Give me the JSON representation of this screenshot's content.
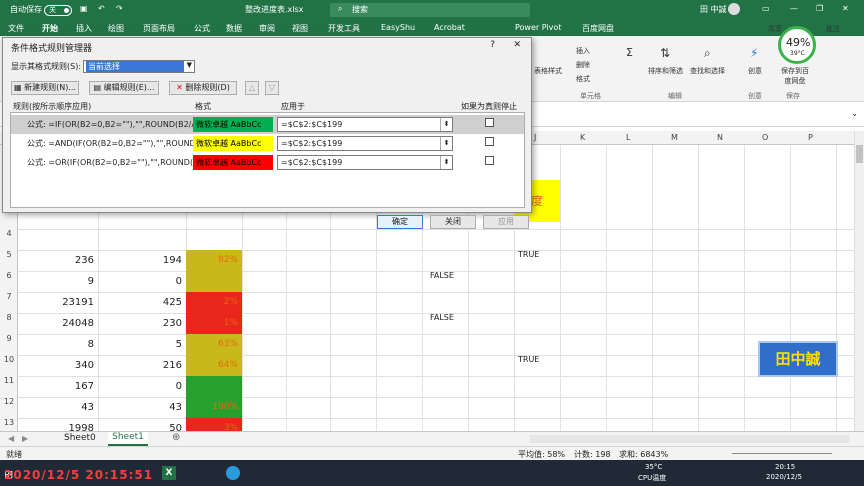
{
  "titlebar": {
    "autosave": "自动保存",
    "autosave_state": "关",
    "filename": "整改进度表.xlsx",
    "user": "田 中誠",
    "search": "搜索"
  },
  "tabs": [
    "文件",
    "开始",
    "插入",
    "绘图",
    "页面布局",
    "公式",
    "数据",
    "审阅",
    "视图",
    "开发工具",
    "EasyShu",
    "Acrobat",
    "Power Pivot",
    "百度网盘"
  ],
  "ribbon": {
    "insert": "插入",
    "delete": "删除",
    "format": "格式",
    "cells_group": "单元格",
    "sort_filter": "排序和筛选",
    "find_select": "查找和选择",
    "edit_group": "编辑",
    "create": "创意",
    "save_cloud": "保存到百度网盘",
    "save_group": "保存",
    "share": "共享",
    "comment": "批注",
    "table_style": "表格样式",
    "cpu_pct": "49%",
    "cpu_temp": "39°C"
  },
  "dialog": {
    "title": "条件格式规则管理器",
    "show_label": "显示其格式规则(S):",
    "show_value": "当前选择",
    "new_rule": "新建规则(N)...",
    "edit_rule": "编辑规则(E)...",
    "delete_rule": "删除规则(D)",
    "col_rule": "规则(按所示顺序应用)",
    "col_format": "格式",
    "col_applies": "应用于",
    "col_stop": "如果为真则停止",
    "rules": [
      {
        "formula": "公式: =IF(OR(B2=0,B2=\"\"),\"\",ROUND(B2/A...",
        "preview": "微软卓越  AaBbCc",
        "applies": "=$C$2:$C$199",
        "bg": "#00b050"
      },
      {
        "formula": "公式: =AND(IF(OR(B2=0,B2=\"\"),\"\",ROUND(B...",
        "preview": "微软卓越  AaBbCc",
        "applies": "=$C$2:$C$199",
        "bg": "#ffff00"
      },
      {
        "formula": "公式: =OR(IF(OR(B2=0,B2=\"\"),\"\",ROUND(...",
        "preview": "微软卓越  AaBbCc",
        "applies": "=$C$2:$C$199",
        "bg": "#ff0000"
      }
    ],
    "ok": "确定",
    "close": "关闭",
    "apply": "应用",
    "help": "?",
    "x": "✕"
  },
  "sheet": {
    "columns": [
      "J",
      "K",
      "L",
      "M",
      "N",
      "O",
      "P"
    ],
    "rows": [
      {
        "num": "4",
        "a": "",
        "b": "",
        "c": "",
        "color": ""
      },
      {
        "num": "5",
        "a": "236",
        "b": "194",
        "c": "82%",
        "color": "#c9b81a"
      },
      {
        "num": "6",
        "a": "9",
        "b": "0",
        "c": "",
        "color": "#c9b81a"
      },
      {
        "num": "7",
        "a": "23191",
        "b": "425",
        "c": "2%",
        "color": "#e8261b"
      },
      {
        "num": "8",
        "a": "24048",
        "b": "230",
        "c": "1%",
        "color": "#e8261b"
      },
      {
        "num": "9",
        "a": "8",
        "b": "5",
        "c": "63%",
        "color": "#c9b81a"
      },
      {
        "num": "10",
        "a": "340",
        "b": "216",
        "c": "64%",
        "color": "#c9b81a"
      },
      {
        "num": "11",
        "a": "167",
        "b": "0",
        "c": "",
        "color": "#27a02e"
      },
      {
        "num": "12",
        "a": "43",
        "b": "43",
        "c": "100%",
        "color": "#27a02e"
      },
      {
        "num": "13",
        "a": "1998",
        "b": "50",
        "c": "3%",
        "color": "#e8261b"
      }
    ],
    "true_label": "TRUE",
    "false_label": "FALSE",
    "header_char": "度",
    "stamp": "田中誠"
  },
  "sheettabs": [
    "Sheet0",
    "Sheet1"
  ],
  "status": {
    "ready": "就绪",
    "avg": "平均值: 58%",
    "count": "计数: 198",
    "sum": "求和: 6843%"
  },
  "taskbar": {
    "temp": "35°C",
    "cpu": "CPU温度",
    "time": "20:15",
    "date": "2020/12/5",
    "overlay": "2020/12/5 20:15:51"
  }
}
